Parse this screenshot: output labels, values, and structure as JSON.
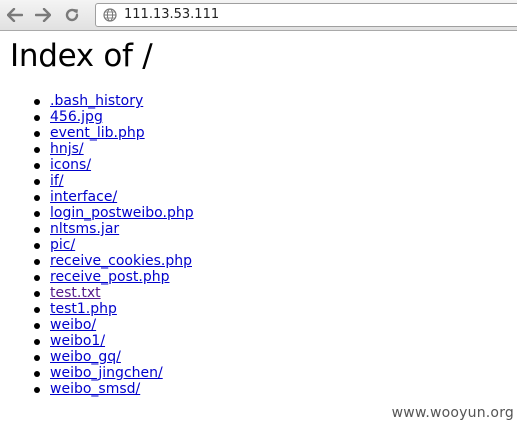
{
  "browser": {
    "url": "111.13.53.111"
  },
  "page": {
    "title": "Index of /",
    "files": [
      ".bash_history",
      "456.jpg",
      "event_lib.php",
      "hnjs/",
      "icons/",
      "if/",
      "interface/",
      "login_postweibo.php",
      "nltsms.jar",
      "pic/",
      "receive_cookies.php",
      "receive_post.php",
      "test.txt",
      "test1.php",
      "weibo/",
      "weibo1/",
      "weibo_gq/",
      "weibo_jingchen/",
      "weibo_smsd/"
    ],
    "visited_index": 12
  },
  "watermark": "www.wooyun.org",
  "icons": {
    "back": "back-arrow-icon",
    "forward": "forward-arrow-icon",
    "reload": "reload-icon",
    "site": "globe-icon"
  },
  "colors": {
    "link": "#0000cc",
    "visited_link": "#551a8b"
  }
}
